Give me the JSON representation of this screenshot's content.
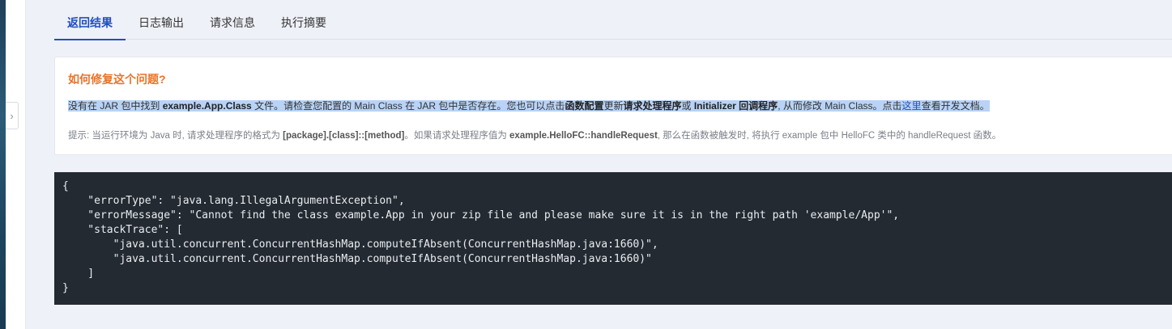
{
  "tabs": [
    {
      "label": "返回结果",
      "active": true
    },
    {
      "label": "日志输出",
      "active": false
    },
    {
      "label": "请求信息",
      "active": false
    },
    {
      "label": "执行摘要",
      "active": false
    }
  ],
  "collapse_glyph": "›",
  "help": {
    "title": "如何修复这个问题?",
    "text": {
      "p1": "没有在 JAR 包中找到 ",
      "class_name": "example.App.Class",
      "p2": " 文件。请检查您配置的 Main Class 在 JAR 包中是否存在。您也可以点击",
      "fn_config": "函数配置",
      "p3": "更新",
      "handler": "请求处理程序",
      "p4": "或 ",
      "initializer": "Initializer 回调程序",
      "p5": ", 从而修改 Main Class。点击",
      "link": "这里",
      "p6": "查看开发文档。"
    },
    "tip": {
      "p1": "提示: 当运行环境为 Java 时, 请求处理程序的格式为 ",
      "format": "[package].[class]::[method]",
      "p2": "。如果请求处理程序值为 ",
      "example": "example.HelloFC::handleRequest",
      "p3": ", 那么在函数被触发时, 将执行 example 包中 HelloFC 类中的 handleRequest 函数。"
    }
  },
  "result_json": "{\n    \"errorType\": \"java.lang.IllegalArgumentException\",\n    \"errorMessage\": \"Cannot find the class example.App in your zip file and please make sure it is in the right path 'example/App'\",\n    \"stackTrace\": [\n        \"java.util.concurrent.ConcurrentHashMap.computeIfAbsent(ConcurrentHashMap.java:1660)\",\n        \"java.util.concurrent.ConcurrentHashMap.computeIfAbsent(ConcurrentHashMap.java:1660)\"\n    ]\n}",
  "colors": {
    "accent": "#1f4fbf",
    "warning_title": "#e8742a",
    "code_bg": "#232a31",
    "selection": "#b8d3f5"
  }
}
